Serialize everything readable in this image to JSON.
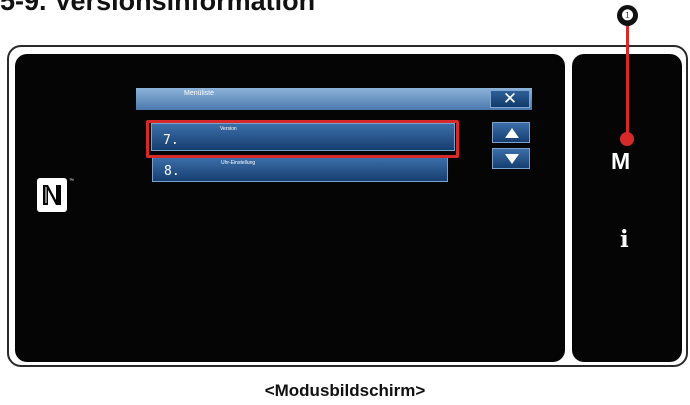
{
  "heading": "5-9. Versionsinformation",
  "callout": {
    "number": "❶"
  },
  "menu": {
    "title": "Menüliste",
    "close_icon": "close-icon",
    "items": [
      {
        "number": "7.",
        "label": "Version"
      },
      {
        "number": "8.",
        "label": "Uhr-Einstellung"
      }
    ],
    "scroll_up_icon": "triangle-up-icon",
    "scroll_down_icon": "triangle-down-icon"
  },
  "side_keys": {
    "mode": "M",
    "info": "i"
  },
  "caption": "<Modusbildschirm>",
  "colors": {
    "highlight": "#d62a2a",
    "screen": "#050505",
    "button_gradient_top": "#3c6ea8",
    "button_gradient_bottom": "#163e70"
  }
}
